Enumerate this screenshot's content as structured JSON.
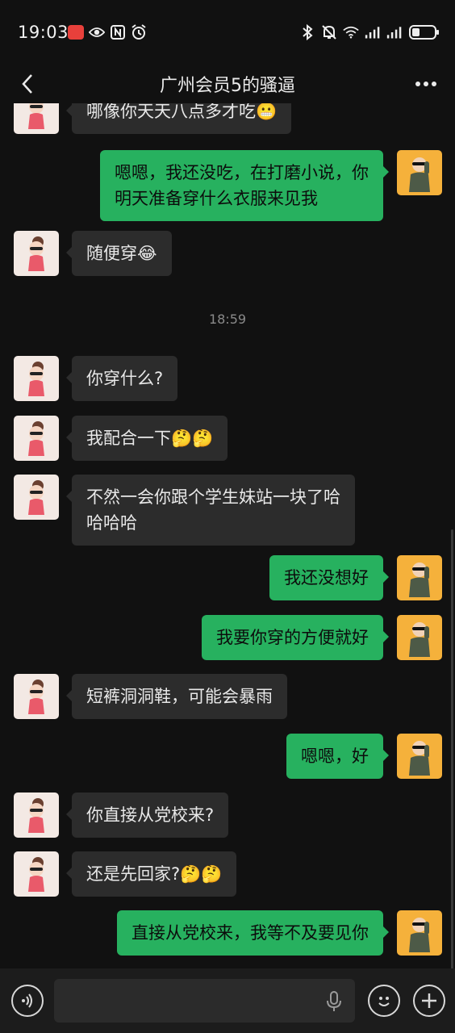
{
  "status_bar": {
    "time": "19:03",
    "left_icons": [
      "app-badge-icon",
      "eye-icon",
      "nfc-icon",
      "alarm-icon"
    ],
    "right_icons": [
      "bluetooth-icon",
      "mute-bell-icon",
      "wifi-icon",
      "signal-icon",
      "signal-icon",
      "battery-icon"
    ]
  },
  "nav": {
    "title": "广州会员5的骚逼"
  },
  "messages": [
    {
      "side": "left",
      "text": "哪像你天天八点多才吃😬"
    },
    {
      "side": "right",
      "text": "嗯嗯，我还没吃，在打磨小说，你\n明天准备穿什么衣服来见我"
    },
    {
      "side": "left",
      "text": "随便穿😂"
    },
    {
      "timestamp": "18:59"
    },
    {
      "side": "left",
      "text": "你穿什么?"
    },
    {
      "side": "left",
      "text": "我配合一下🤔🤔"
    },
    {
      "side": "left",
      "text": "不然一会你跟个学生妹站一块了哈\n哈哈哈"
    },
    {
      "side": "right",
      "text": "我还没想好"
    },
    {
      "side": "right",
      "text": "我要你穿的方便就好"
    },
    {
      "side": "left",
      "text": "短裤洞洞鞋，可能会暴雨"
    },
    {
      "side": "right",
      "text": "嗯嗯，好"
    },
    {
      "side": "left",
      "text": "你直接从党校来?"
    },
    {
      "side": "left",
      "text": "还是先回家?🤔🤔"
    },
    {
      "side": "right",
      "text": "直接从党校来，我等不及要见你"
    }
  ],
  "input_bar": {
    "placeholder": ""
  },
  "colors": {
    "background": "#111111",
    "bubble_received": "#2c2c2c",
    "bubble_sent": "#27b15f",
    "timestamp": "#8a8a8a"
  }
}
